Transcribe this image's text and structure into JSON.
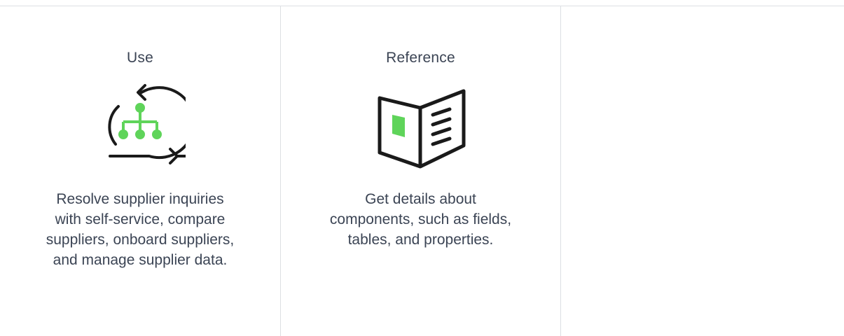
{
  "cards": [
    {
      "title": "Use",
      "icon": "cycle-hierarchy-icon",
      "description": "Resolve supplier inquiries with self-service, compare suppliers, onboard suppliers, and manage supplier data."
    },
    {
      "title": "Reference",
      "icon": "open-book-icon",
      "description": "Get details about components, such as fields, tables, and properties."
    }
  ],
  "colors": {
    "accent": "#5fd45a",
    "text": "#3b4454",
    "divider": "#dcdfe3",
    "icon_stroke": "#1a1a1a"
  }
}
